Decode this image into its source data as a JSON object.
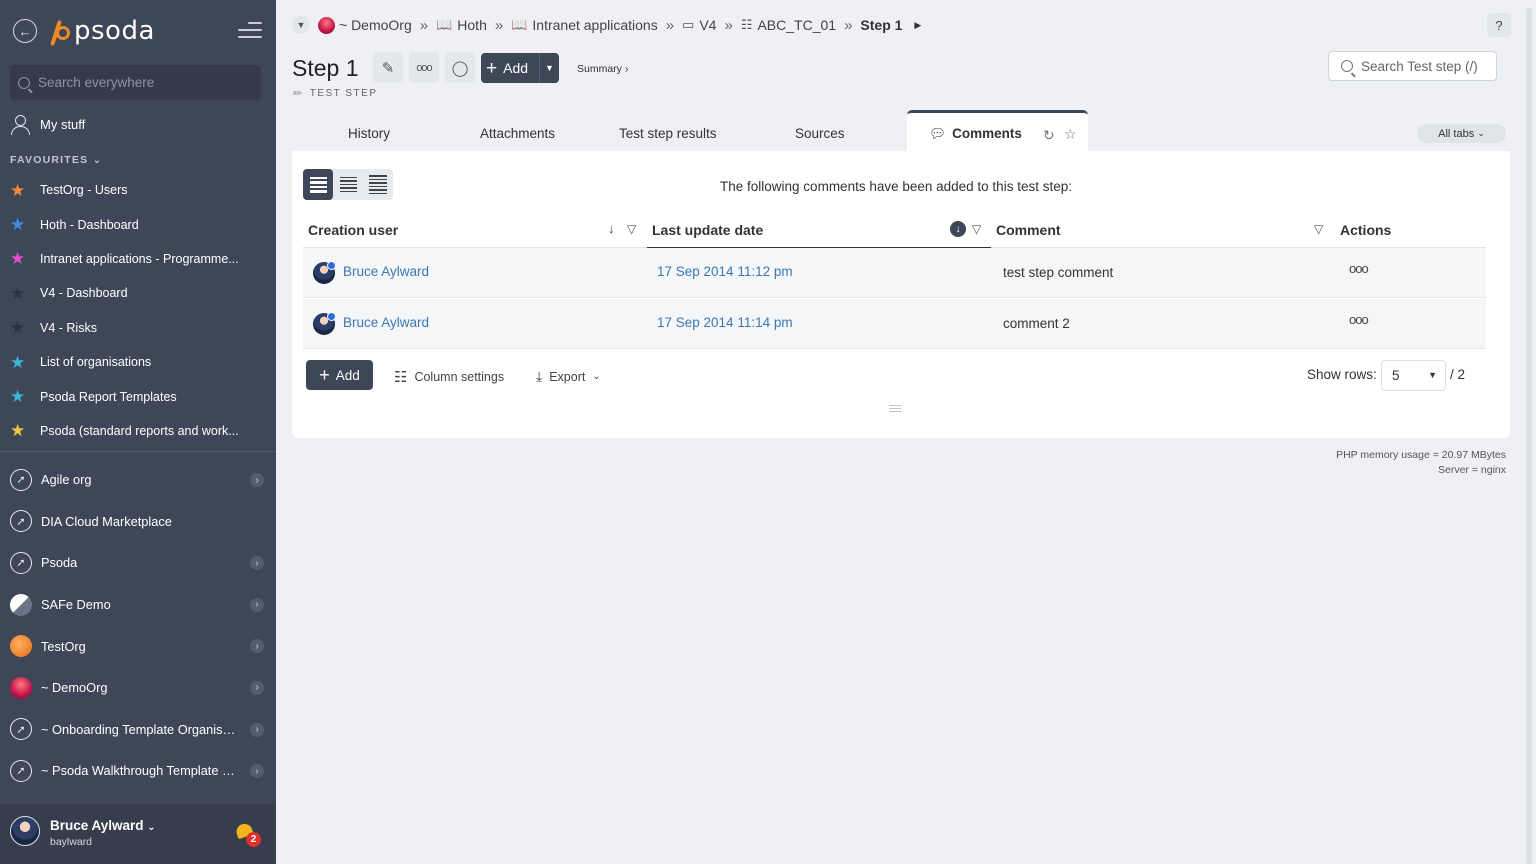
{
  "sidebar": {
    "logo": "psoda",
    "search_placeholder": "Search everywhere",
    "my_stuff": "My stuff",
    "favourites_heading": "FAVOURITES",
    "favourites": [
      {
        "label": "TestOrg - Users",
        "color": "#f5883a"
      },
      {
        "label": "Hoth - Dashboard",
        "color": "#3f8de8"
      },
      {
        "label": "Intranet applications - Programme...",
        "color": "#e44fd0"
      },
      {
        "label": "V4 - Dashboard",
        "color": "#2c3340"
      },
      {
        "label": "V4 - Risks",
        "color": "#2c3340"
      },
      {
        "label": "List of organisations",
        "color": "#3bb6d6"
      },
      {
        "label": "Psoda Report Templates",
        "color": "#3bb6d6"
      },
      {
        "label": "Psoda (standard reports and work...",
        "color": "#f2c43a"
      }
    ],
    "orgs": [
      {
        "label": "Agile org",
        "icon": "compass-icon",
        "style": "compass",
        "chevron": true
      },
      {
        "label": "DIA Cloud Marketplace",
        "icon": "compass-icon",
        "style": "compass",
        "chevron": false
      },
      {
        "label": "Psoda",
        "icon": "compass-icon",
        "style": "compass",
        "chevron": true
      },
      {
        "label": "SAFe Demo",
        "icon": "safe-logo-icon",
        "style": "safe",
        "chevron": true
      },
      {
        "label": "TestOrg",
        "icon": "testorg-logo-icon",
        "style": "test",
        "chevron": true
      },
      {
        "label": "~ DemoOrg",
        "icon": "demoorg-logo-icon",
        "style": "demo",
        "chevron": true
      },
      {
        "label": "~ Onboarding Template Organisa...",
        "icon": "compass-icon",
        "style": "compass",
        "chevron": true
      },
      {
        "label": "~ Psoda Walkthrough Template P...",
        "icon": "compass-icon",
        "style": "compass",
        "chevron": true
      }
    ],
    "user": {
      "name": "Bruce Aylward",
      "login": "baylward",
      "notifications": "2"
    }
  },
  "breadcrumb": [
    {
      "label": "~ DemoOrg",
      "icon": "demoorg-logo-icon"
    },
    {
      "label": "Hoth",
      "icon": "book-icon"
    },
    {
      "label": "Intranet applications",
      "icon": "book-icon"
    },
    {
      "label": "V4",
      "icon": "folder-icon"
    },
    {
      "label": "ABC_TC_01",
      "icon": "columns-icon"
    },
    {
      "label": "Step 1",
      "icon": ""
    }
  ],
  "header": {
    "title": "Step 1",
    "type_label": "TEST STEP",
    "add_label": "Add",
    "summary_label": "Summary ›",
    "search_placeholder": "Search Test step (/)",
    "help": "?"
  },
  "tabs": [
    {
      "label": "History"
    },
    {
      "label": "Attachments"
    },
    {
      "label": "Test step results"
    },
    {
      "label": "Sources"
    },
    {
      "label": "Comments",
      "active": true
    }
  ],
  "all_tabs_label": "All tabs",
  "comments_panel": {
    "caption": "The following comments have been added to this test step:",
    "columns": [
      "Creation user",
      "Last update date",
      "Comment",
      "Actions"
    ],
    "rows": [
      {
        "user": "Bruce Aylward",
        "date": "17 Sep 2014 11:12 pm",
        "comment": "test step comment",
        "actions": "ooo"
      },
      {
        "user": "Bruce Aylward",
        "date": "17 Sep 2014 11:14 pm",
        "comment": "comment 2",
        "actions": "ooo"
      }
    ],
    "add_label": "Add",
    "column_settings_label": "Column settings",
    "export_label": "Export",
    "show_rows_label": "Show rows:",
    "rows_value": "5",
    "pages_label": "/ 2"
  },
  "footer": {
    "memory": "PHP memory usage = 20.97 MBytes",
    "server": "Server = nginx"
  },
  "colors": {
    "accent": "#3e4758",
    "link": "#3b78b5",
    "brand_orange": "#f08a24"
  }
}
